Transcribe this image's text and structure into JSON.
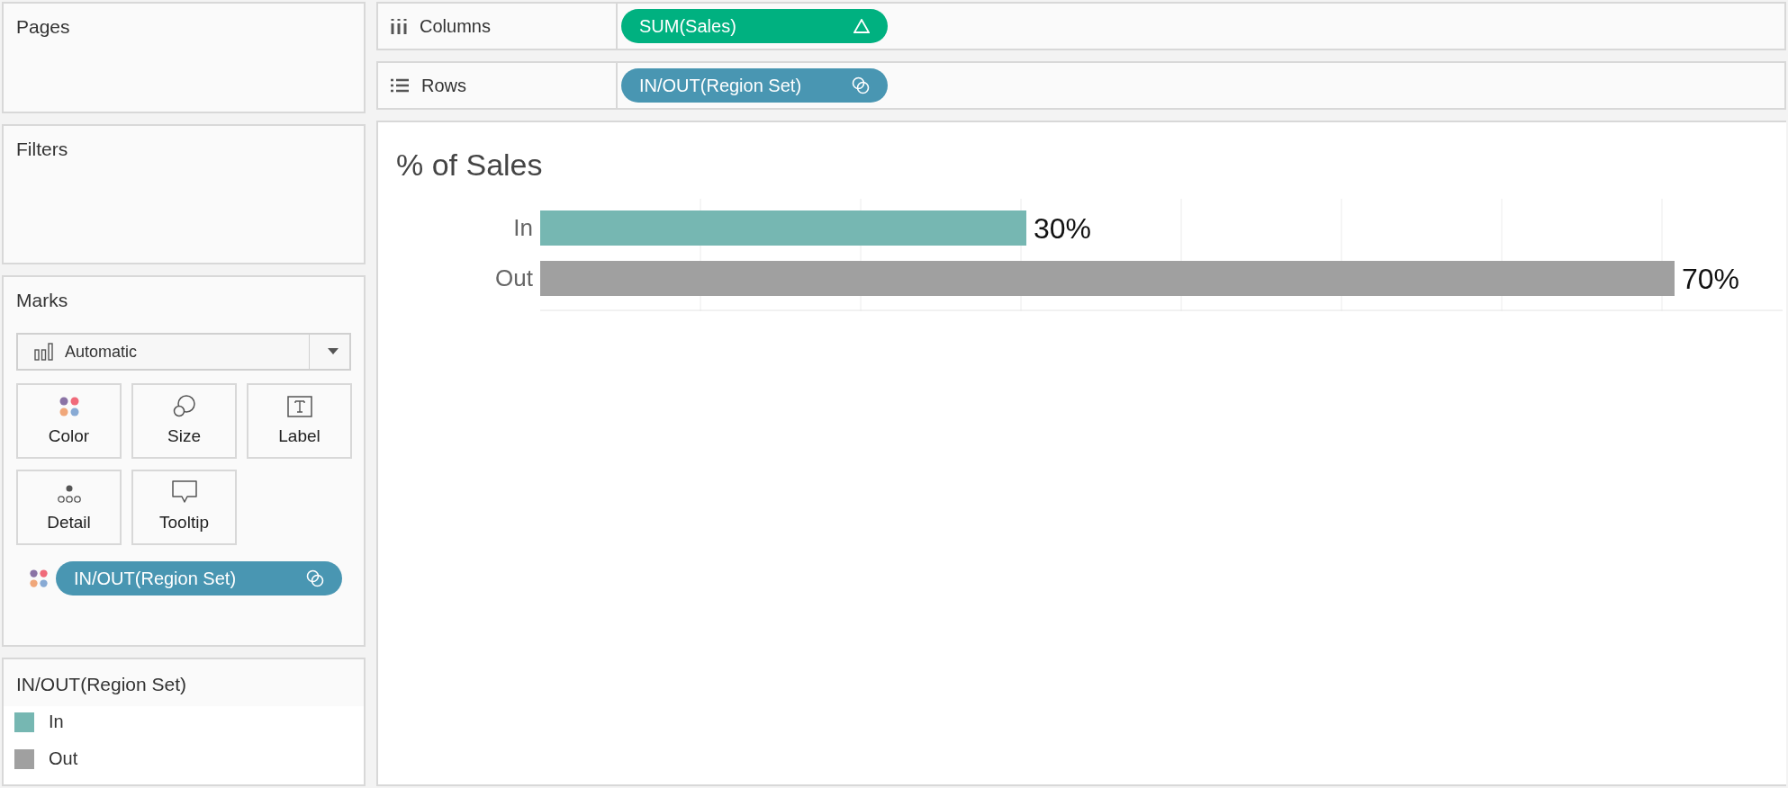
{
  "side": {
    "pages": {
      "title": "Pages"
    },
    "filters": {
      "title": "Filters"
    },
    "marks": {
      "title": "Marks",
      "mark_type": "Automatic",
      "cards": [
        {
          "kind": "color",
          "label": "Color"
        },
        {
          "kind": "size",
          "label": "Size"
        },
        {
          "kind": "label",
          "label": "Label"
        },
        {
          "kind": "detail",
          "label": "Detail"
        },
        {
          "kind": "tooltip",
          "label": "Tooltip"
        }
      ],
      "fields": [
        {
          "kind": "set",
          "label": "IN/OUT(Region Set)"
        }
      ]
    },
    "legend": {
      "title": "IN/OUT(Region Set)",
      "items": [
        {
          "label": "In",
          "color": "#76b7b2"
        },
        {
          "label": "Out",
          "color": "#a0a0a0"
        }
      ]
    }
  },
  "shelves": [
    {
      "kind": "columns",
      "label": "Columns",
      "pills": [
        {
          "kind": "measure",
          "label": "SUM(Sales)"
        }
      ]
    },
    {
      "kind": "rows",
      "label": "Rows",
      "pills": [
        {
          "kind": "set",
          "label": "IN/OUT(Region Set)"
        }
      ]
    }
  ],
  "view": {
    "chart_data": {
      "type": "bar",
      "title": "% of Sales",
      "orientation": "horizontal",
      "categories": [
        "In",
        "Out"
      ],
      "values": [
        30,
        70
      ],
      "data_labels": true,
      "value_labels": [
        "30%",
        "70%"
      ]
    }
  }
}
